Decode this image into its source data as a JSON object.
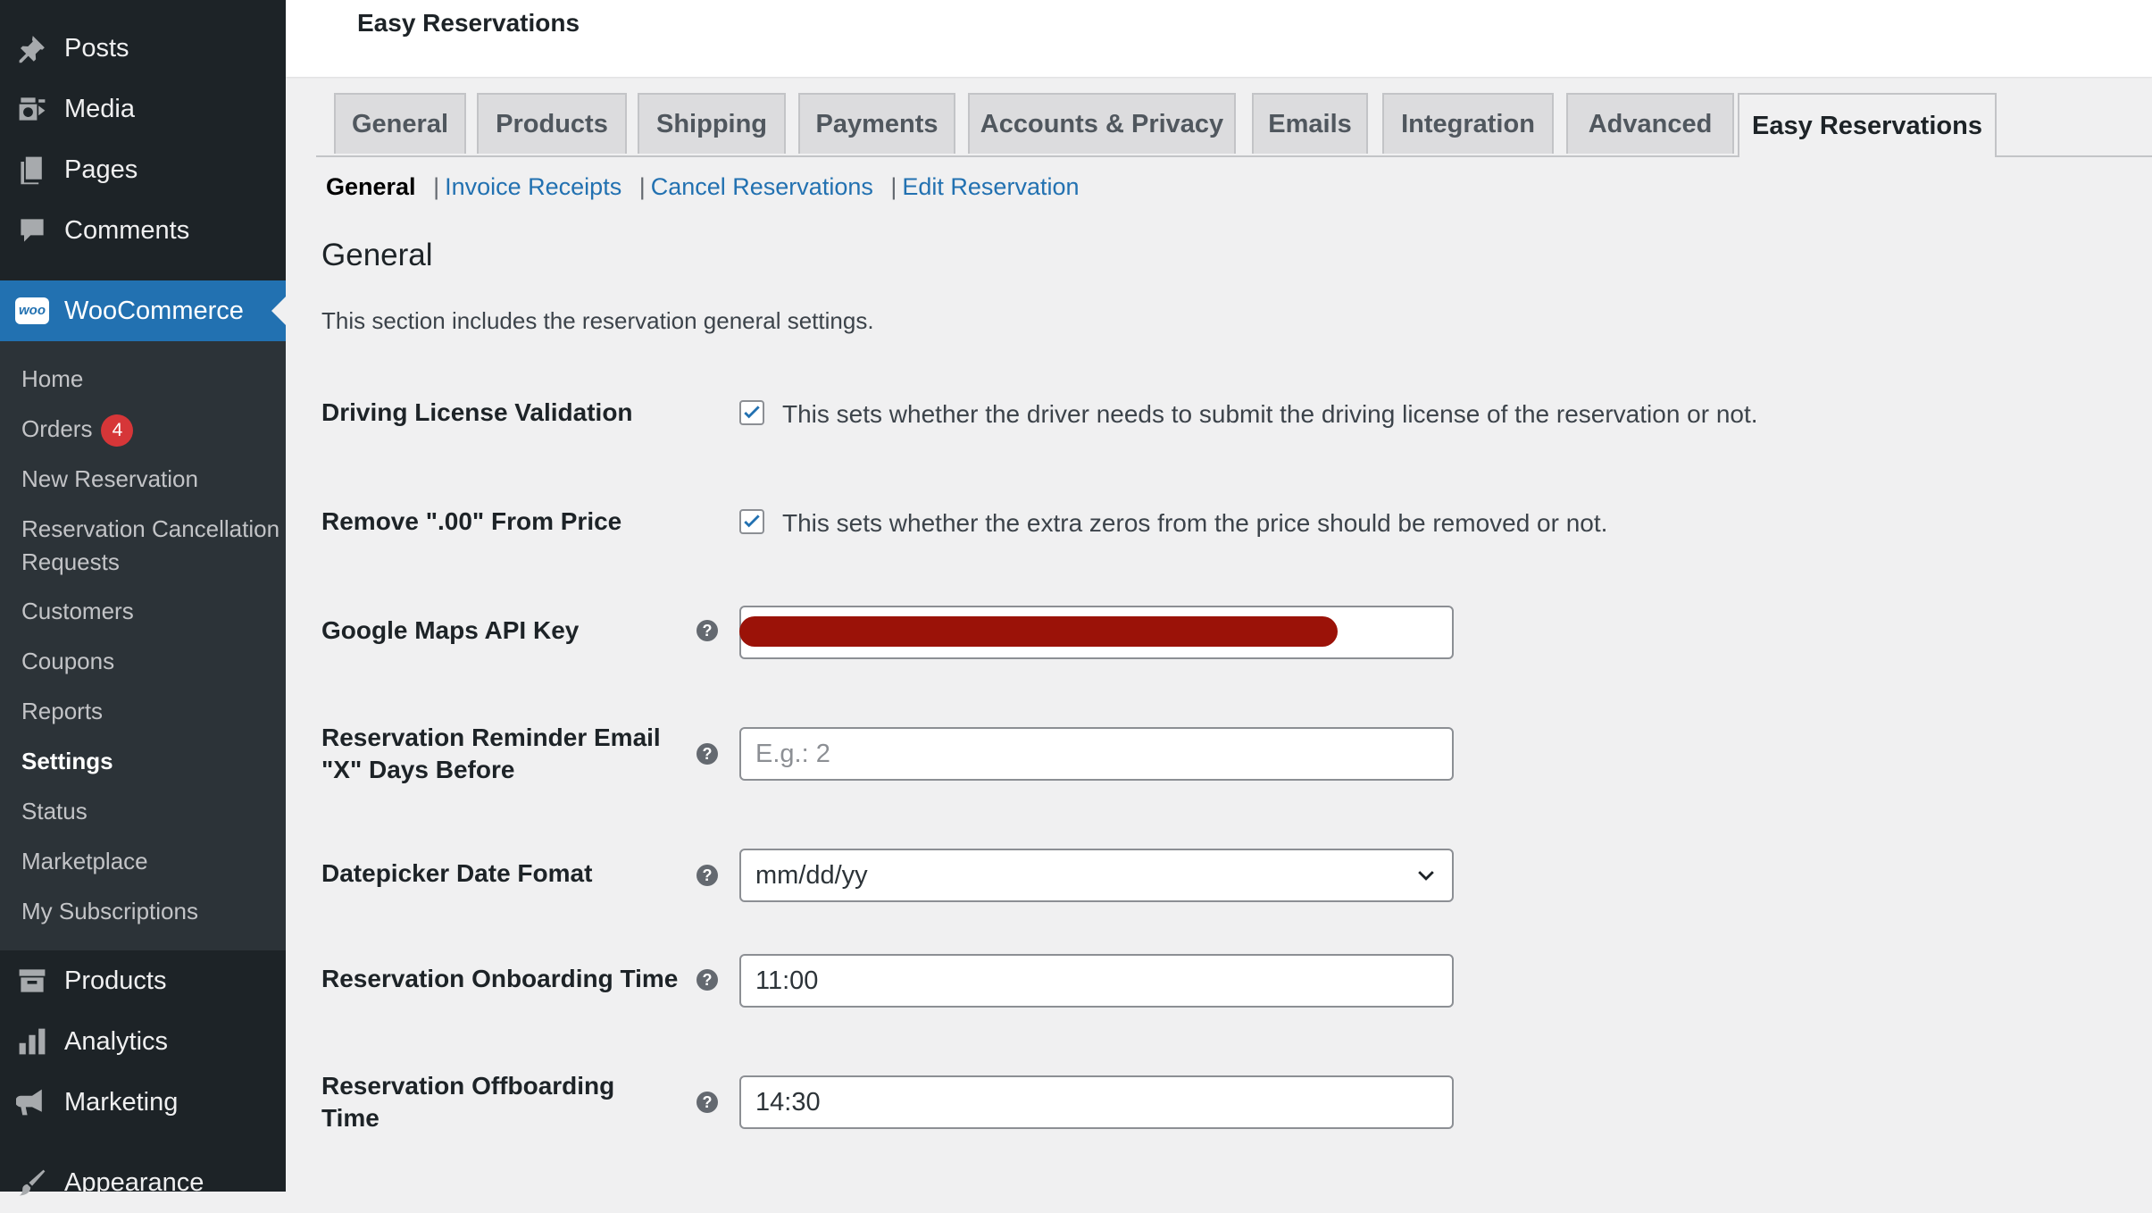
{
  "sidebar": {
    "top_items": [
      {
        "label": "Posts",
        "icon": "pin-icon"
      },
      {
        "label": "Media",
        "icon": "media-icon"
      },
      {
        "label": "Pages",
        "icon": "pages-icon"
      },
      {
        "label": "Comments",
        "icon": "comment-icon"
      }
    ],
    "woocommerce": {
      "label": "WooCommerce",
      "icon": "woo-icon",
      "icon_text": "woo"
    },
    "submenu": [
      {
        "label": "Home"
      },
      {
        "label": "Orders",
        "badge": "4"
      },
      {
        "label": "New Reservation"
      },
      {
        "label": "Reservation Cancellation Requests"
      },
      {
        "label": "Customers"
      },
      {
        "label": "Coupons"
      },
      {
        "label": "Reports"
      },
      {
        "label": "Settings",
        "current": true
      },
      {
        "label": "Status"
      },
      {
        "label": "Marketplace"
      },
      {
        "label": "My Subscriptions"
      }
    ],
    "bottom_items": [
      {
        "label": "Products",
        "icon": "archive-icon"
      },
      {
        "label": "Analytics",
        "icon": "bar-chart-icon"
      },
      {
        "label": "Marketing",
        "icon": "megaphone-icon"
      },
      {
        "label": "Appearance",
        "icon": "brush-icon"
      }
    ]
  },
  "header": {
    "title": "Easy Reservations"
  },
  "tabs": [
    {
      "label": "General"
    },
    {
      "label": "Products"
    },
    {
      "label": "Shipping"
    },
    {
      "label": "Payments"
    },
    {
      "label": "Accounts & Privacy"
    },
    {
      "label": "Emails"
    },
    {
      "label": "Integration"
    },
    {
      "label": "Advanced"
    },
    {
      "label": "Easy Reservations",
      "active": true
    }
  ],
  "subnav": {
    "current": "General",
    "separator": "|",
    "links": [
      "Invoice Receipts",
      "Cancel Reservations",
      "Edit Reservation"
    ]
  },
  "section": {
    "title": "General",
    "description": "This section includes the reservation general settings."
  },
  "fields": {
    "driving_license": {
      "label": "Driving License Validation",
      "checked": true,
      "description": "This sets whether the driver needs to submit the driving license of the reservation or not."
    },
    "remove_zeros": {
      "label": "Remove \".00\" From Price",
      "checked": true,
      "description": "This sets whether the extra zeros from the price should be removed or not."
    },
    "maps_api_key": {
      "label": "Google Maps API Key",
      "value": ""
    },
    "reminder_days": {
      "label_line1": "Reservation Reminder Email",
      "label_line2": "\"X\" Days Before",
      "value": "",
      "placeholder": "E.g.: 2"
    },
    "date_format": {
      "label": "Datepicker Date Fomat",
      "value": "mm/dd/yy"
    },
    "onboarding_time": {
      "label": "Reservation Onboarding Time",
      "value": "11:00"
    },
    "offboarding_time": {
      "label_line1": "Reservation Offboarding",
      "label_line2": "Time",
      "value": "14:30"
    }
  },
  "help_glyph": "?",
  "colors": {
    "sidebar_bg": "#1d2327",
    "submenu_bg": "#2c3338",
    "accent": "#2271b1",
    "badge": "#d63638",
    "redaction": "#9b1208"
  }
}
